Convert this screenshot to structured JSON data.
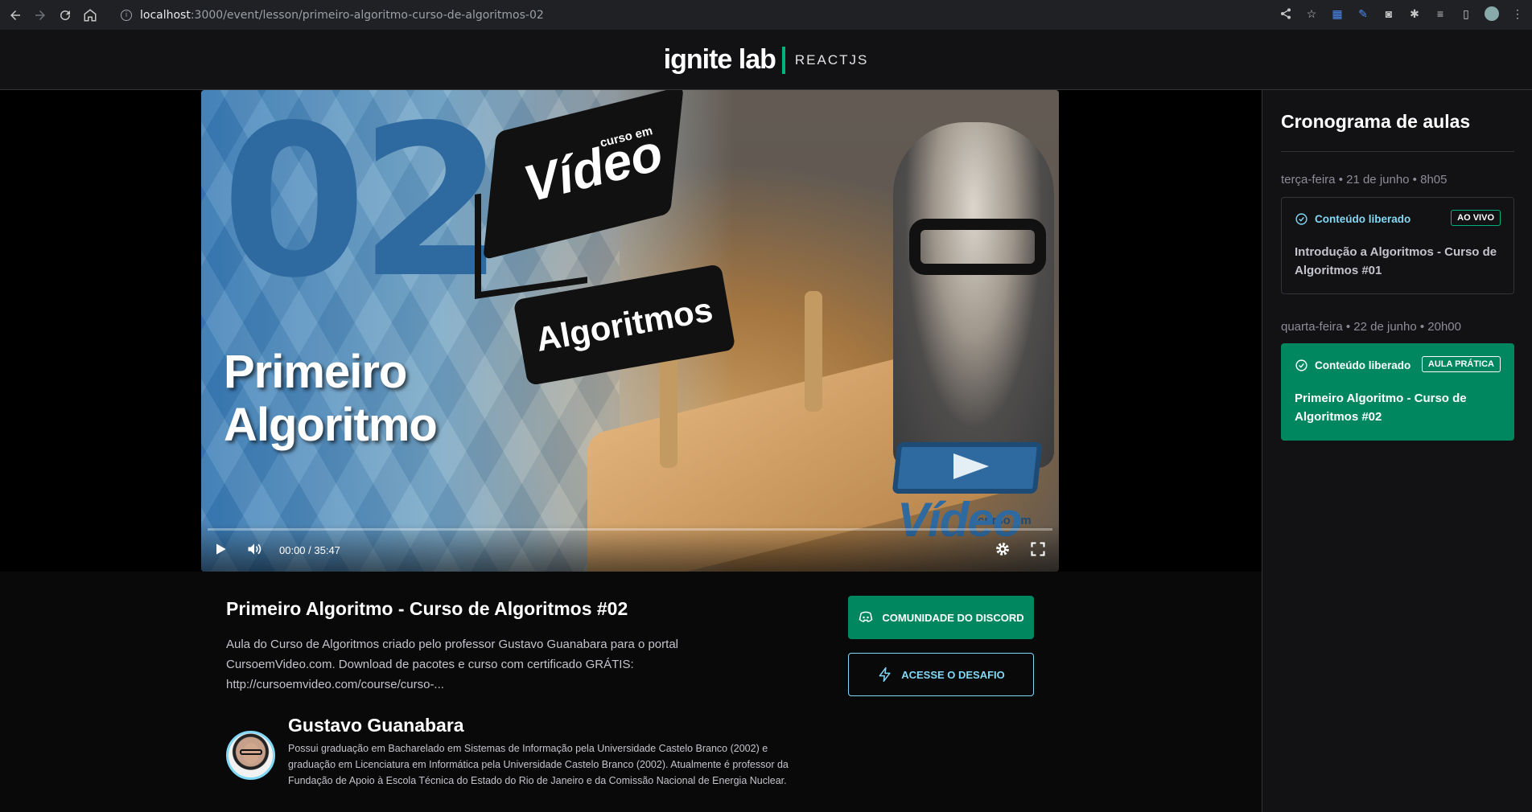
{
  "browser": {
    "url_host": "localhost",
    "url_path": ":3000/event/lesson/primeiro-algoritmo-curso-de-algoritmos-02"
  },
  "header": {
    "logo_main": "ignite lab",
    "logo_sub": "REACTJS"
  },
  "video": {
    "number": "02",
    "title_line1": "Primeiro",
    "title_line2": "Algoritmo",
    "badge_text": "Vídeo",
    "badge_small": "curso em",
    "algoritmos_label": "Algoritmos",
    "brand_small": "curso em",
    "brand_text": "Vídeo",
    "time": "00:00 / 35:47",
    "progress": 0
  },
  "lesson": {
    "title": "Primeiro Algoritmo - Curso de Algoritmos #02",
    "description": "Aula do Curso de Algoritmos criado pelo professor Gustavo Guanabara para o portal CursoemVideo.com. Download de pacotes e curso com certificado GRÁTIS: http://cursoemvideo.com/course/curso-...",
    "discord_label": "Comunidade do Discord",
    "challenge_label": "Acesse o desafio"
  },
  "teacher": {
    "name": "Gustavo Guanabara",
    "bio": "Possui graduação em Bacharelado em Sistemas de Informação pela Universidade Castelo Branco (2002) e graduação em Licenciatura em Informática pela Universidade Castelo Branco (2002). Atualmente é professor da Fundação de Apoio à Escola Técnica do Estado do Rio de Janeiro e da Comissão Nacional de Energia Nuclear."
  },
  "sidebar": {
    "title": "Cronograma de aulas",
    "lessons": [
      {
        "date": "terça-feira • 21 de junho • 8h05",
        "status": "Conteúdo liberado",
        "tag": "AO VIVO",
        "title": "Introdução a Algoritmos - Curso de Algoritmos #01"
      },
      {
        "date": "quarta-feira • 22 de junho • 20h00",
        "status": "Conteúdo liberado",
        "tag": "AULA PRÁTICA",
        "title": "Primeiro Algoritmo - Curso de Algoritmos #02"
      }
    ]
  },
  "colors": {
    "accent_green": "#00875f",
    "accent_blue": "#81d8f7",
    "background": "#09090a",
    "panel": "#121214"
  }
}
